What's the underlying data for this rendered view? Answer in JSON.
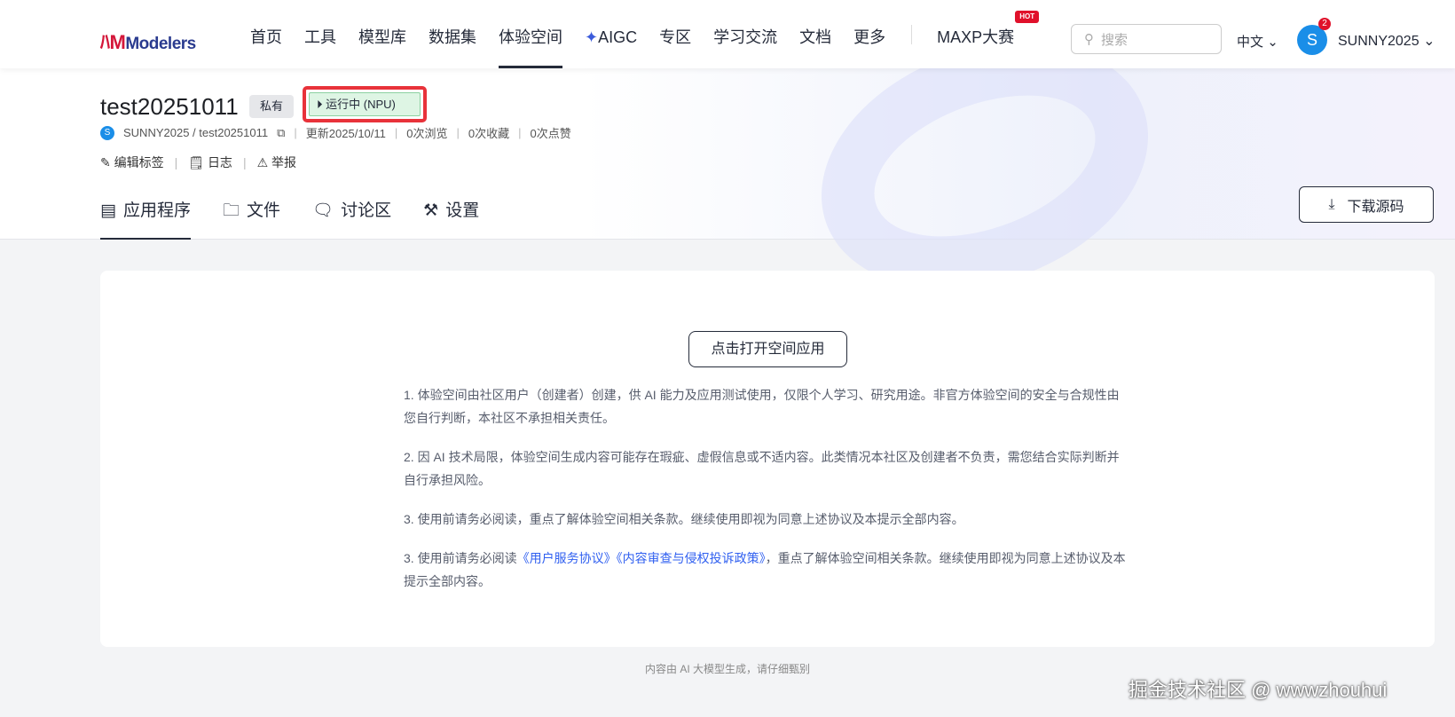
{
  "header": {
    "logo": "Modelers",
    "nav": [
      "首页",
      "工具",
      "模型库",
      "数据集",
      "体验空间",
      "AIGC",
      "专区",
      "学习交流",
      "文档",
      "更多"
    ],
    "contest": "MAXP大赛",
    "hot": "HOT",
    "search_placeholder": "搜索",
    "lang": "中文",
    "badge": "2",
    "avatar": "S",
    "user": "SUNNY2025"
  },
  "space": {
    "title": "test20251011",
    "visibility": "私有",
    "status": "运行中 (NPU)",
    "owner_avatar": "S",
    "path": "SUNNY2025 / test20251011",
    "updated": "更新2025/10/11",
    "views": "0次浏览",
    "favorites": "0次收藏",
    "likes": "0次点赞",
    "actions": [
      "编辑标签",
      "日志",
      "举报"
    ]
  },
  "tabs": [
    "应用程序",
    "文件",
    "讨论区",
    "设置"
  ],
  "download": "下载源码",
  "main": {
    "open_button": "点击打开空间应用",
    "note1": "1. 体验空间由社区用户（创建者）创建，供 AI 能力及应用测试使用，仅限个人学习、研究用途。非官方体验空间的安全与合规性由您自行判断，本社区不承担相关责任。",
    "note2": "2. 因 AI 技术局限，体验空间生成内容可能存在瑕疵、虚假信息或不适内容。此类情况本社区及创建者不负责，需您结合实际判断并自行承担风险。",
    "note3": "3. 使用前请务必阅读，重点了解体验空间相关条款。继续使用即视为同意上述协议及本提示全部内容。",
    "note4_pre": "3. 使用前请务必阅读",
    "link1": "《用户服务协议》",
    "link2": "《内容审查与侵权投诉政策》",
    "note4_post": "，重点了解体验空间相关条款。继续使用即视为同意上述协议及本提示全部内容。"
  },
  "footer": "内容由 AI 大模型生成，请仔细甄别",
  "watermark": "掘金技术社区 @ wwwzhouhui"
}
